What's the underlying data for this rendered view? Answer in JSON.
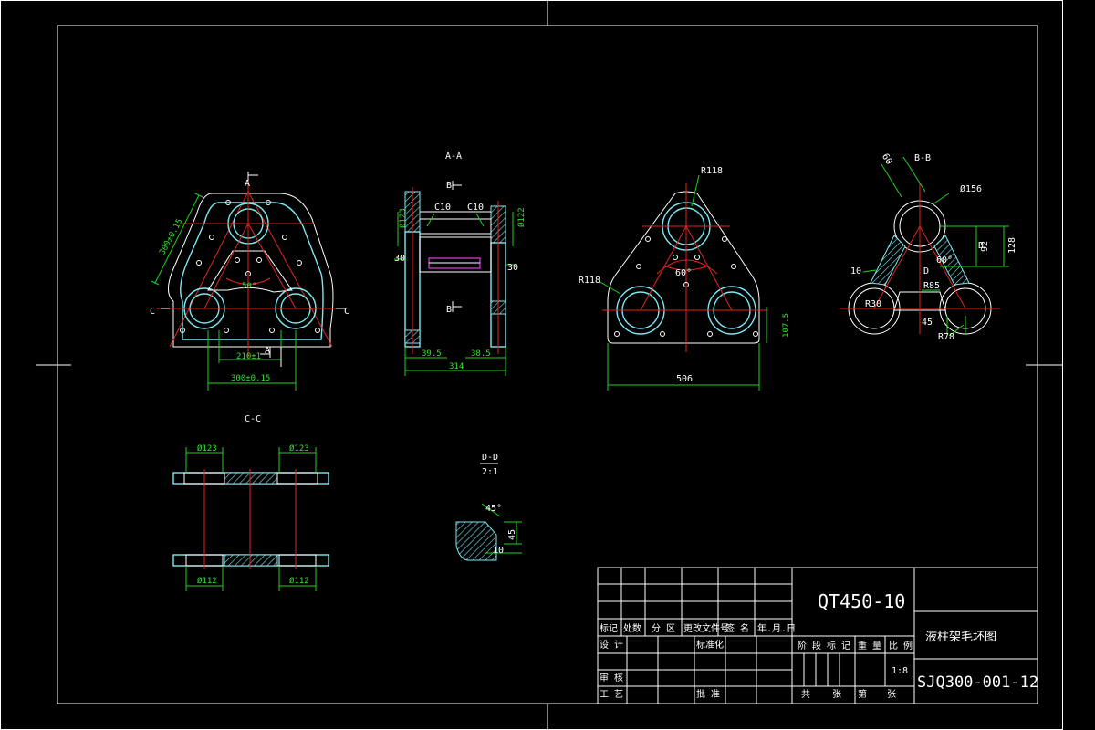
{
  "view_labels": {
    "section_aa": "A-A",
    "section_bb": "B-B",
    "section_cc": "C-C",
    "detail_dd": "D-D",
    "detail_dd_scale": "2:1"
  },
  "marks": {
    "a": "A",
    "b": "B",
    "c": "C",
    "d": "D"
  },
  "dimensions": {
    "front_slant": "300±0.15",
    "front_angle": "50°",
    "front_210": "210±1",
    "front_300": "300±0.15",
    "aa_c10_left": "C10",
    "aa_c10_right": "C10",
    "aa_dia_left": "Ø123",
    "aa_dia_right": "Ø122",
    "aa_30_left": "30",
    "aa_30_right": "30",
    "aa_395": "39.5",
    "aa_385": "38.5",
    "aa_314": "314",
    "mid_r118_top": "R118",
    "mid_r118_left": "R118",
    "mid_60": "60°",
    "mid_506": "506",
    "mid_105": "107.5",
    "bb_60": "60",
    "bb_dia156": "Ø156",
    "bb_92": "92",
    "bb_128": "128",
    "bb_60deg": "60°",
    "bb_r85": "R85",
    "bb_r30": "R30",
    "bb_45": "45",
    "bb_r78": "R78",
    "bb_10": "10",
    "cc_dia123_left": "Ø123",
    "cc_dia123_right": "Ø123",
    "cc_dia112_left": "Ø112",
    "cc_dia112_right": "Ø112",
    "dd_45": "45°",
    "dd_45b": "45",
    "dd_10": "10"
  },
  "title_block": {
    "material": "QT450-10",
    "part_name": "液柱架毛坯图",
    "drawing_no": "SJQ300-001-12",
    "scale": "1:8",
    "row_labels": [
      "标记",
      "处数",
      "分 区",
      "更改文件号",
      "签 名",
      "年.月.日"
    ],
    "designer": "设 计",
    "standardization": "标准化",
    "stage_mark": "阶 段 标 记",
    "weight": "重 量",
    "scale_label": "比 例",
    "review": "审 核",
    "process": "工 艺",
    "approve": "批 准",
    "sheets": [
      "共",
      "张",
      "第",
      "张"
    ]
  }
}
